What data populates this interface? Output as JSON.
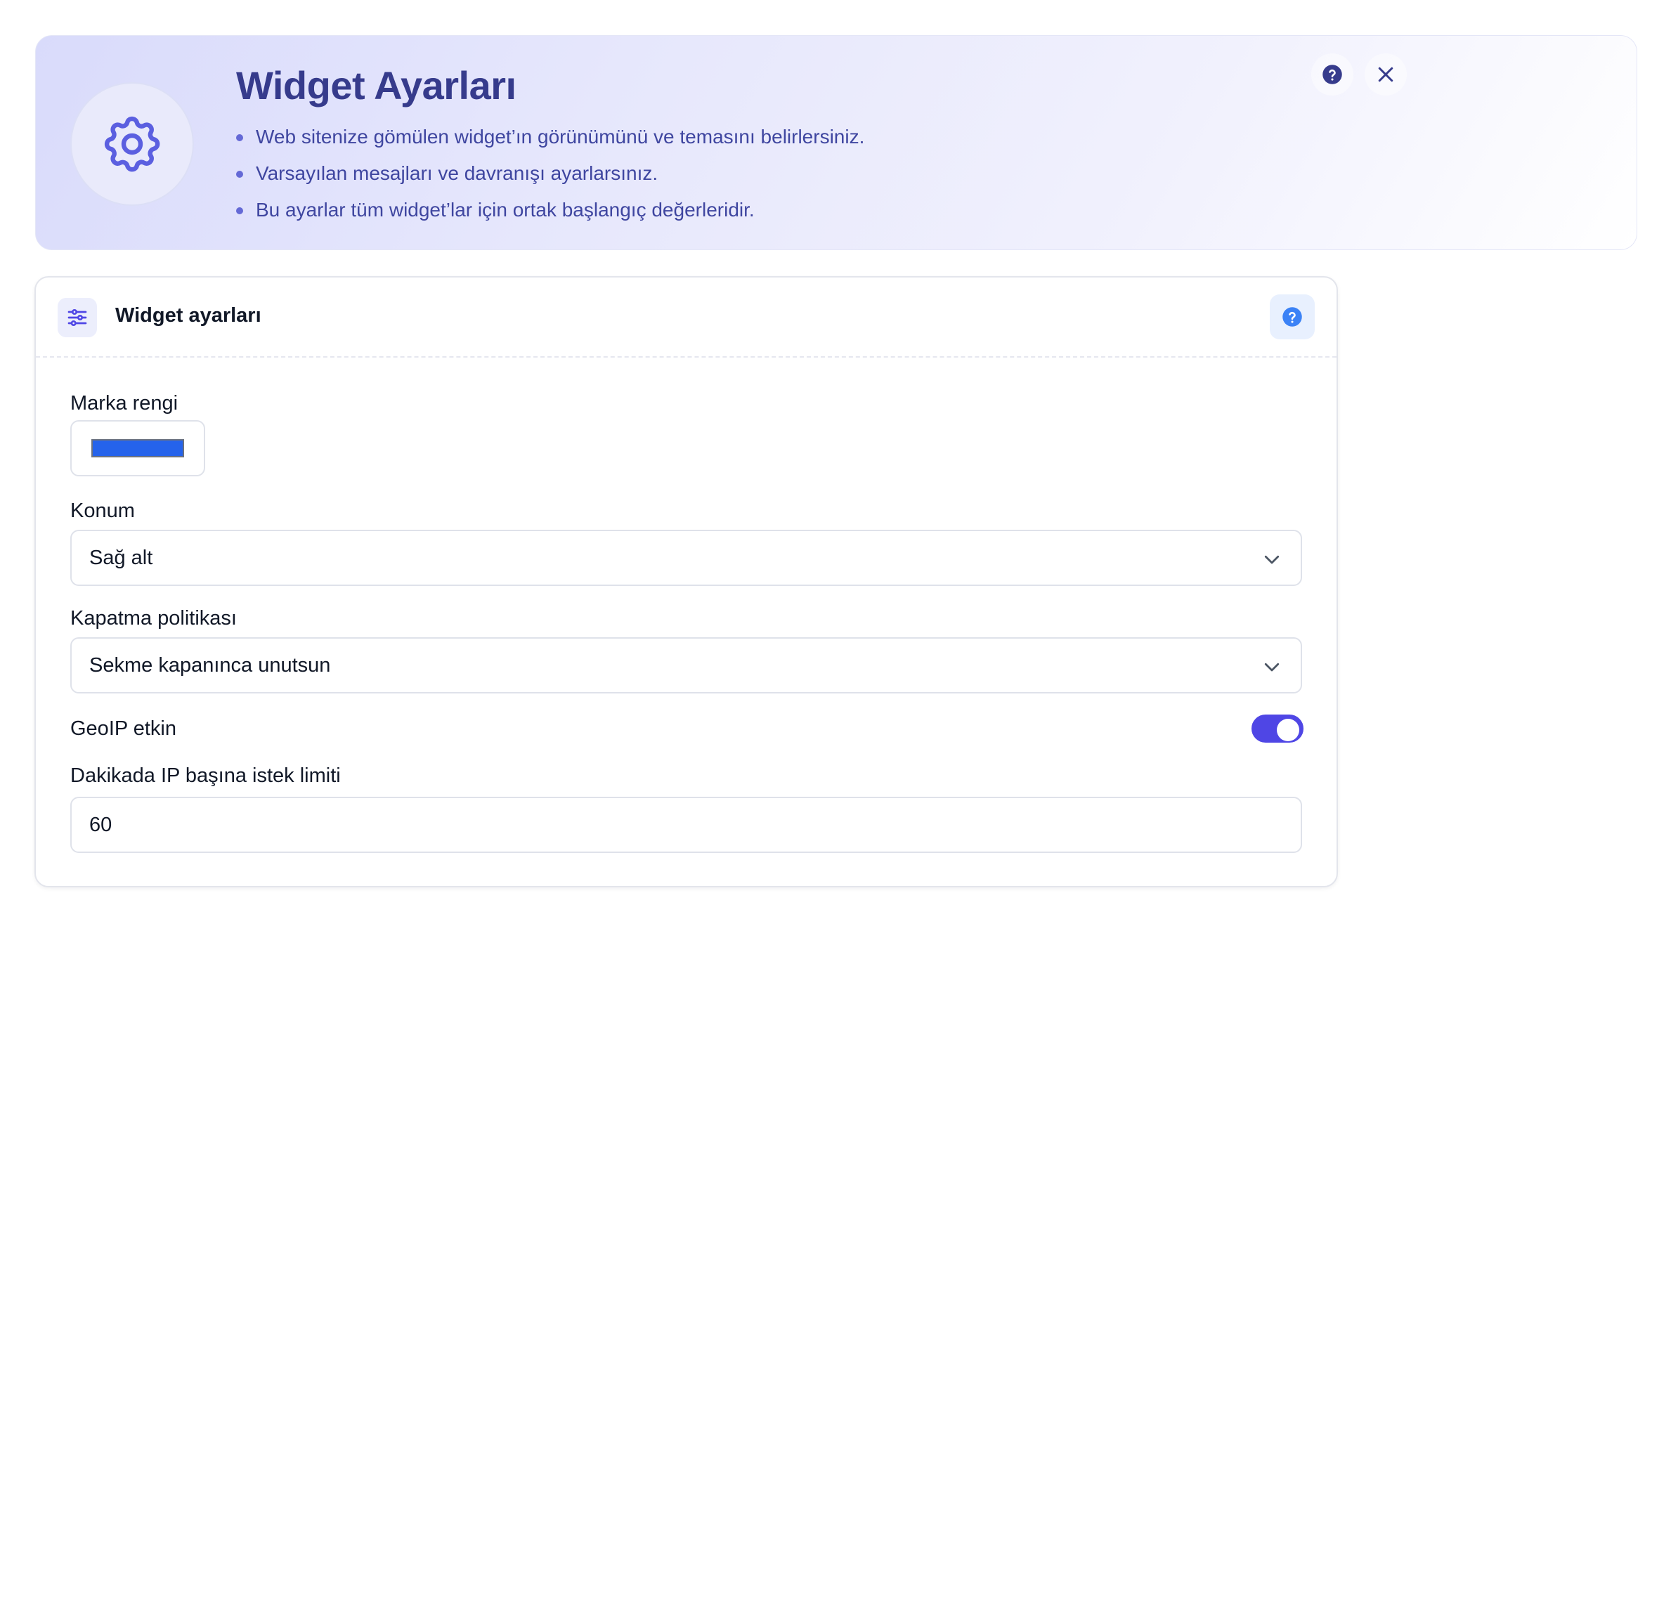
{
  "banner": {
    "title": "Widget Ayarları",
    "bullets": [
      "Web sitenize gömülen widget’ın görünümünü ve temasını belirlersiniz.",
      "Varsayılan mesajları ve davranışı ayarlarsınız.",
      "Bu ayarlar tüm widget’lar için ortak başlangıç değerleridir."
    ],
    "badge_icon": "gear-icon",
    "help_icon": "question-circle-icon",
    "close_icon": "close-icon"
  },
  "card": {
    "title": "Widget ayarları",
    "header_icon": "sliders-icon",
    "help_icon": "question-circle-icon"
  },
  "form": {
    "brand_color": {
      "label": "Marka rengi",
      "value": "#2563eb"
    },
    "position": {
      "label": "Konum",
      "selected": "Sağ alt"
    },
    "close_policy": {
      "label": "Kapatma politikası",
      "selected": "Sekme kapanınca unutsun"
    },
    "geoip": {
      "label": "GeoIP etkin",
      "enabled": true
    },
    "rate_limit": {
      "label": "Dakikada IP başına istek limiti",
      "value": "60"
    }
  },
  "colors": {
    "accent": "#4f46e5",
    "banner_title": "#363b8c",
    "toggle_on": "#4f46e5",
    "help_blue": "#3b82f6"
  }
}
